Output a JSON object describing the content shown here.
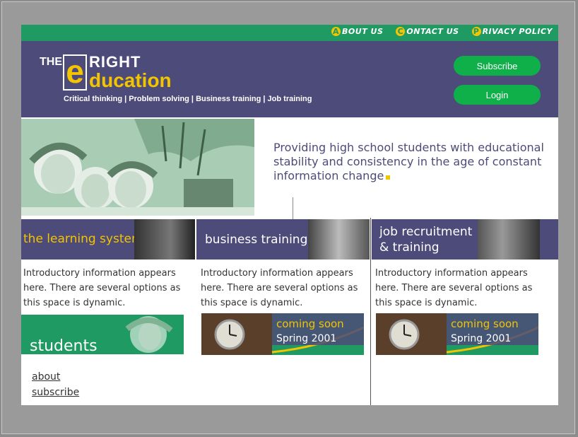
{
  "nav": {
    "links": [
      {
        "initial": "A",
        "label": "BOUT US"
      },
      {
        "initial": "C",
        "label": "ONTACT US"
      },
      {
        "initial": "P",
        "label": "RIVACY POLICY"
      }
    ]
  },
  "logo": {
    "the": "THE",
    "e": "e",
    "right": "RIGHT",
    "ducation": "ducation",
    "tagline": "Critical thinking | Problem solving | Business training | Job training"
  },
  "buttons": {
    "subscribe": "Subscribe",
    "login": "Login"
  },
  "headline": "Providing high school students with educational stability and consistency in the age of constant information change",
  "sections": [
    {
      "title": "the learning system",
      "intro": "Introductory information appears here. There are several options as this space is dynamic."
    },
    {
      "title": "business training",
      "intro": "Introductory information appears here. There are several options as this space is dynamic."
    },
    {
      "title_line1": "job recruitment",
      "title_line2": "& training",
      "intro": "Introductory information appears here. There are several options as this space is dynamic."
    }
  ],
  "students_banner": "students",
  "coming": {
    "line1": "coming soon",
    "line2": "Spring 2001"
  },
  "footer_links": {
    "about": "about",
    "subscribe": "subscribe"
  },
  "colors": {
    "purple": "#4d4b79",
    "green": "#1f9a63",
    "yellow": "#f3c400",
    "button": "#0fb04a"
  }
}
